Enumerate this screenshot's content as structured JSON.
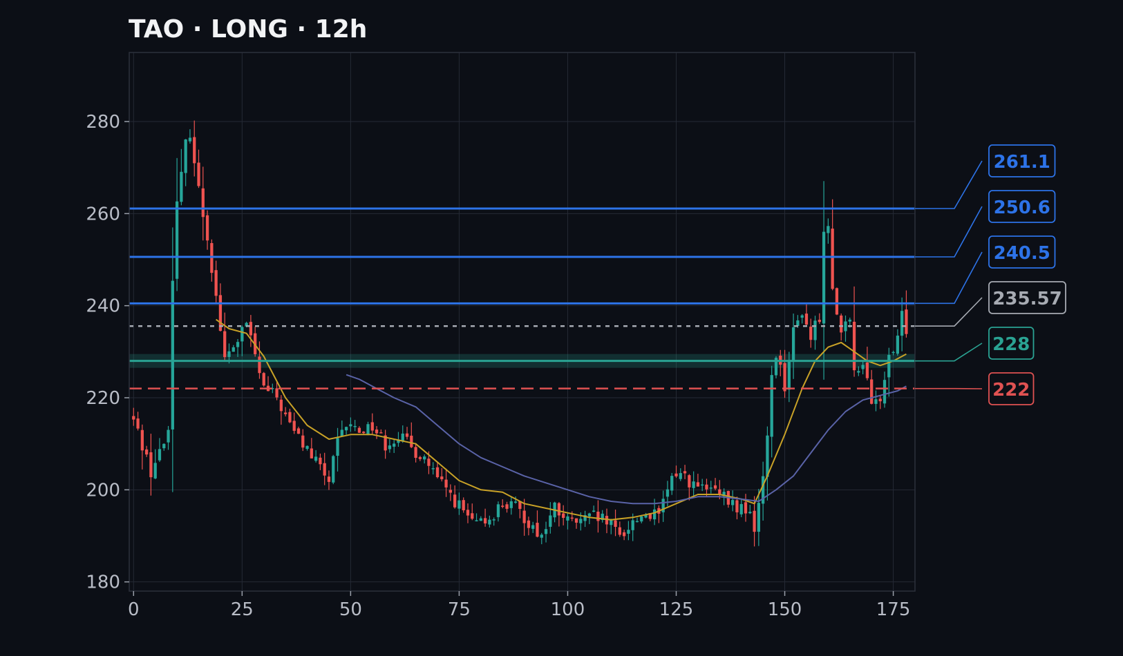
{
  "title": "TAO · LONG · 12h",
  "chart_data": {
    "type": "candlestick",
    "title": "TAO · LONG · 12h",
    "xlabel": "",
    "ylabel": "",
    "xlim": [
      -1,
      180
    ],
    "ylim": [
      178,
      295
    ],
    "x_ticks": [
      0,
      25,
      50,
      75,
      100,
      125,
      150,
      175
    ],
    "y_ticks": [
      180,
      200,
      220,
      240,
      260,
      280
    ],
    "grid": true,
    "close_anchors": [
      [
        0,
        215
      ],
      [
        2,
        210
      ],
      [
        4,
        204
      ],
      [
        6,
        208
      ],
      [
        8,
        213
      ],
      [
        9,
        247
      ],
      [
        10,
        262
      ],
      [
        11,
        268
      ],
      [
        12,
        275
      ],
      [
        13,
        278
      ],
      [
        15,
        265
      ],
      [
        17,
        255
      ],
      [
        19,
        242
      ],
      [
        21,
        228
      ],
      [
        23,
        231
      ],
      [
        26,
        236
      ],
      [
        28,
        229
      ],
      [
        30,
        222
      ],
      [
        33,
        220
      ],
      [
        36,
        214
      ],
      [
        39,
        210
      ],
      [
        42,
        206
      ],
      [
        45,
        202
      ],
      [
        47,
        210
      ],
      [
        49,
        214
      ],
      [
        52,
        213
      ],
      [
        55,
        214
      ],
      [
        58,
        210
      ],
      [
        61,
        212
      ],
      [
        64,
        209
      ],
      [
        67,
        207
      ],
      [
        70,
        202
      ],
      [
        73,
        199
      ],
      [
        76,
        195
      ],
      [
        79,
        192
      ],
      [
        82,
        194
      ],
      [
        85,
        197
      ],
      [
        88,
        196
      ],
      [
        91,
        193
      ],
      [
        94,
        190
      ],
      [
        97,
        196
      ],
      [
        100,
        193
      ],
      [
        103,
        193
      ],
      [
        106,
        194
      ],
      [
        109,
        193
      ],
      [
        112,
        190
      ],
      [
        115,
        193
      ],
      [
        118,
        195
      ],
      [
        121,
        194
      ],
      [
        123,
        200
      ],
      [
        125,
        204
      ],
      [
        127,
        203
      ],
      [
        129,
        201
      ],
      [
        131,
        200
      ],
      [
        133,
        200
      ],
      [
        136,
        198
      ],
      [
        139,
        196
      ],
      [
        141,
        196
      ],
      [
        143,
        192
      ],
      [
        145,
        202
      ],
      [
        146,
        212
      ],
      [
        147,
        225
      ],
      [
        148,
        230
      ],
      [
        150,
        223
      ],
      [
        152,
        234
      ],
      [
        154,
        239
      ],
      [
        156,
        233
      ],
      [
        158,
        238
      ],
      [
        159,
        255
      ],
      [
        160,
        258
      ],
      [
        161,
        245
      ],
      [
        163,
        234
      ],
      [
        165,
        236
      ],
      [
        166,
        226
      ],
      [
        168,
        228
      ],
      [
        170,
        218
      ],
      [
        172,
        220
      ],
      [
        174,
        228
      ],
      [
        176,
        232
      ],
      [
        177,
        238
      ],
      [
        178,
        235
      ]
    ],
    "series": [
      {
        "name": "",
        "kind": "ema-fast",
        "color": "#c9a227",
        "points": [
          [
            19,
            237
          ],
          [
            22,
            235
          ],
          [
            26,
            234
          ],
          [
            30,
            229
          ],
          [
            35,
            220
          ],
          [
            40,
            214
          ],
          [
            45,
            211
          ],
          [
            50,
            212
          ],
          [
            55,
            212
          ],
          [
            60,
            211
          ],
          [
            65,
            210
          ],
          [
            70,
            206
          ],
          [
            75,
            202
          ],
          [
            80,
            200
          ],
          [
            85,
            199.5
          ],
          [
            90,
            197
          ],
          [
            95,
            196
          ],
          [
            100,
            195
          ],
          [
            105,
            194
          ],
          [
            110,
            193.5
          ],
          [
            115,
            194
          ],
          [
            120,
            195
          ],
          [
            125,
            197
          ],
          [
            130,
            199
          ],
          [
            135,
            199
          ],
          [
            140,
            198
          ],
          [
            143,
            197
          ],
          [
            146,
            203
          ],
          [
            150,
            212
          ],
          [
            154,
            222
          ],
          [
            157,
            228
          ],
          [
            160,
            231
          ],
          [
            163,
            232
          ],
          [
            166,
            230
          ],
          [
            169,
            228
          ],
          [
            172,
            227
          ],
          [
            175,
            228
          ],
          [
            178,
            229.5
          ]
        ]
      },
      {
        "name": "",
        "kind": "ema-slow",
        "color": "#5a63a8",
        "points": [
          [
            49,
            225
          ],
          [
            52,
            224
          ],
          [
            56,
            222
          ],
          [
            60,
            220
          ],
          [
            65,
            218
          ],
          [
            70,
            214
          ],
          [
            75,
            210
          ],
          [
            80,
            207
          ],
          [
            85,
            205
          ],
          [
            90,
            203
          ],
          [
            95,
            201.5
          ],
          [
            100,
            200
          ],
          [
            105,
            198.5
          ],
          [
            110,
            197.5
          ],
          [
            115,
            197
          ],
          [
            120,
            197
          ],
          [
            125,
            197.5
          ],
          [
            130,
            198.5
          ],
          [
            135,
            198.5
          ],
          [
            140,
            198
          ],
          [
            144,
            197.5
          ],
          [
            148,
            200
          ],
          [
            152,
            203
          ],
          [
            156,
            208
          ],
          [
            160,
            213
          ],
          [
            164,
            217
          ],
          [
            168,
            219.5
          ],
          [
            172,
            220.5
          ],
          [
            176,
            221.5
          ],
          [
            178,
            222.5
          ]
        ]
      }
    ],
    "levels": [
      {
        "value": 261.1,
        "label": "261.1",
        "color": "#2d73e8",
        "style": "solid",
        "role": "tp"
      },
      {
        "value": 250.6,
        "label": "250.6",
        "color": "#2d73e8",
        "style": "solid",
        "role": "tp"
      },
      {
        "value": 240.5,
        "label": "240.5",
        "color": "#2d73e8",
        "style": "solid",
        "role": "tp"
      },
      {
        "value": 235.57,
        "label": "235.57",
        "color": "#a7abb3",
        "style": "dotted",
        "role": "current"
      },
      {
        "value": 228,
        "label": "228",
        "color": "#2aa393",
        "style": "solid",
        "role": "entry",
        "zone": [
          226.5,
          229.5
        ]
      },
      {
        "value": 222,
        "label": "222",
        "color": "#e05252",
        "style": "dashed",
        "role": "stop"
      }
    ],
    "colors": {
      "up": "#26a69a",
      "down": "#ef5350",
      "grid": "#252a35",
      "background": "#0c0f16"
    }
  }
}
